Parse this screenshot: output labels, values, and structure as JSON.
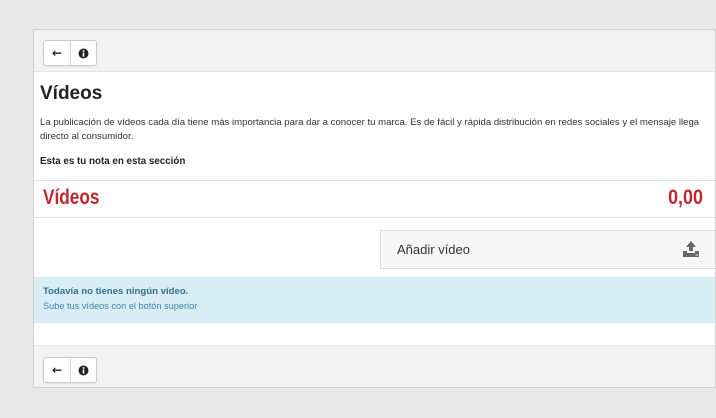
{
  "toolbar": {
    "back_icon": "arrow-left-icon",
    "back_glyph": "←",
    "info_icon": "info-icon",
    "info_glyph": "❶"
  },
  "section": {
    "title": "Vídeos",
    "description": "La publicación de vídeos cada día tiene más importancia para dar a conocer tu marca. Es de fácil y rápida distribución en redes sociales y el mensaje llega directo al consumidor.",
    "note_label": "Esta es tu nota en esta sección"
  },
  "score": {
    "title": "Vídeos",
    "value": "0,00",
    "color": "#c1272d"
  },
  "add_video": {
    "label": "Añadir vídeo",
    "icon": "upload-icon"
  },
  "alert": {
    "title": "Todavía no tienes ningún vídeo.",
    "subtitle": "Sube tus vídeos con el botón superior",
    "background": "#d9edf7"
  }
}
